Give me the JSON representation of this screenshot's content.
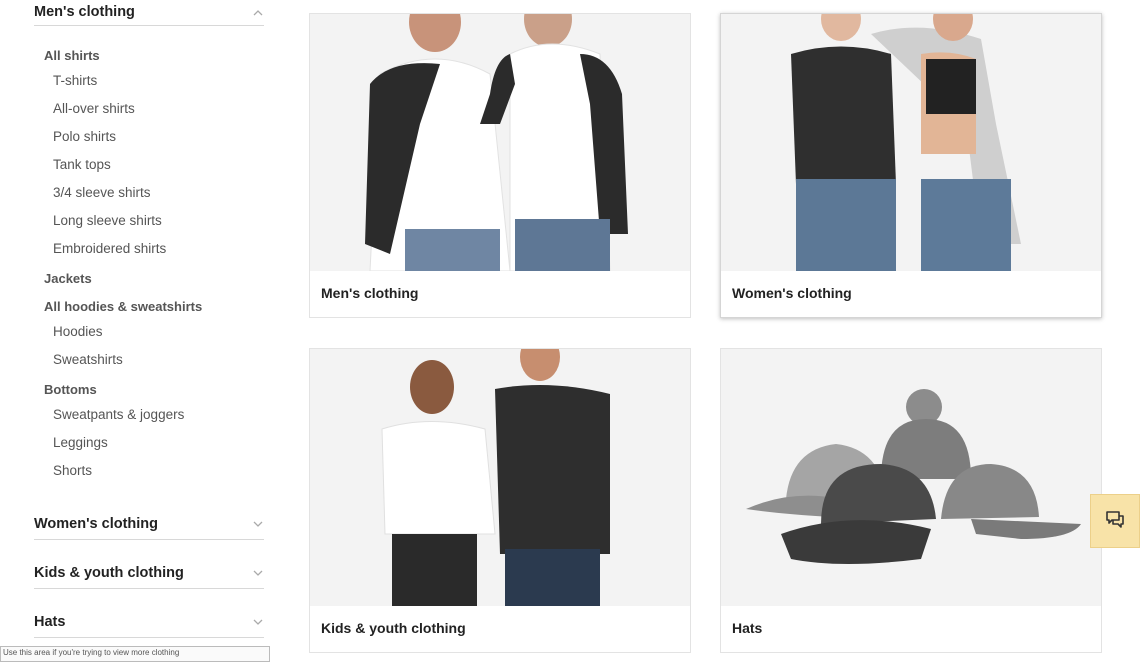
{
  "sidebar": {
    "mens": {
      "label": "Men's clothing",
      "groups": [
        {
          "title": "All shirts",
          "items": [
            "T-shirts",
            "All-over shirts",
            "Polo shirts",
            "Tank tops",
            "3/4 sleeve shirts",
            "Long sleeve shirts",
            "Embroidered shirts"
          ]
        },
        {
          "title": "Jackets",
          "items": []
        },
        {
          "title": "All hoodies & sweatshirts",
          "items": [
            "Hoodies",
            "Sweatshirts"
          ]
        },
        {
          "title": "Bottoms",
          "items": [
            "Sweatpants & joggers",
            "Leggings",
            "Shorts"
          ]
        }
      ]
    },
    "womens": {
      "label": "Women's clothing"
    },
    "kids": {
      "label": "Kids & youth clothing"
    },
    "hats": {
      "label": "Hats"
    },
    "tooltip": "Use this area if you're trying to view more clothing"
  },
  "cards": [
    {
      "label": "Men's clothing"
    },
    {
      "label": "Women's clothing"
    },
    {
      "label": "Kids & youth clothing"
    },
    {
      "label": "Hats"
    }
  ],
  "chat": {
    "icon": "chat-icon"
  },
  "colors": {
    "chat_bg": "#f8e3a8",
    "image_bg": "#f2f2f2"
  }
}
